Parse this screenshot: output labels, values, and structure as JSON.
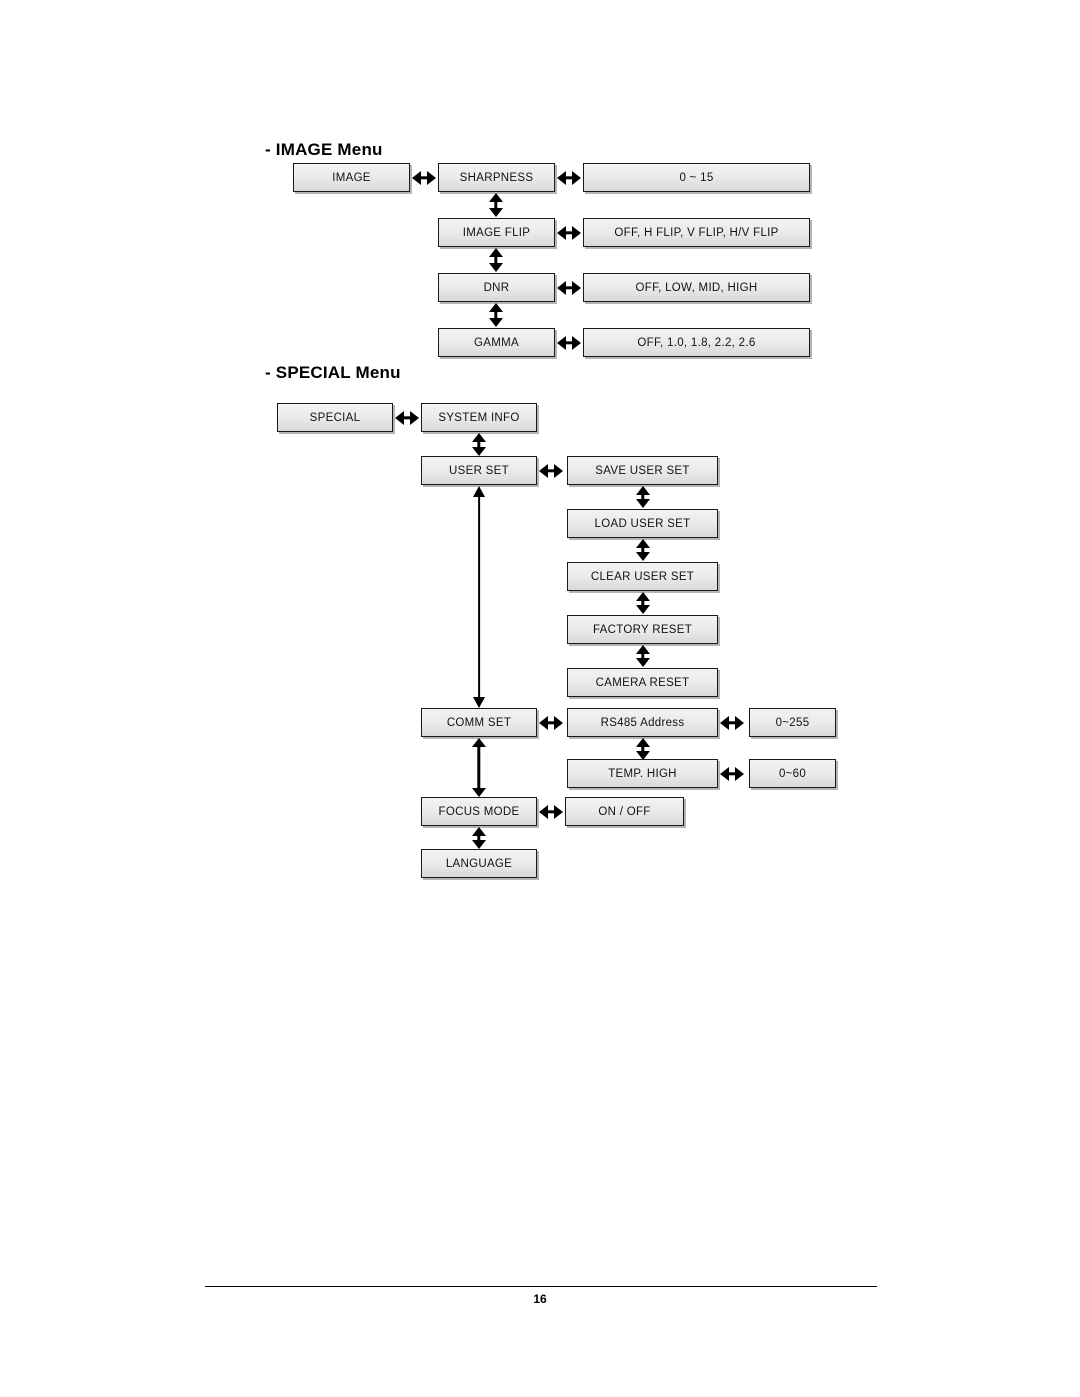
{
  "document": {
    "page_number": "16"
  },
  "sections": [
    {
      "id": "image-menu",
      "title": "- IMAGE Menu",
      "root": {
        "label": "IMAGE"
      },
      "rows": [
        {
          "item": "SHARPNESS",
          "values": "0 ~ 15"
        },
        {
          "item": "IMAGE FLIP",
          "values": "OFF, H FLIP, V FLIP, H/V FLIP"
        },
        {
          "item": "DNR",
          "values": "OFF, LOW, MID, HIGH"
        },
        {
          "item": "GAMMA",
          "values": "OFF, 1.0, 1.8, 2.2, 2.6"
        }
      ]
    },
    {
      "id": "special-menu",
      "title": "- SPECIAL Menu",
      "root": {
        "label": "SPECIAL"
      },
      "rows": [
        {
          "item": "SYSTEM INFO"
        },
        {
          "item": "USER SET"
        },
        {
          "item": "COMM SET"
        },
        {
          "item": "FOCUS MODE"
        },
        {
          "item": "LANGUAGE"
        }
      ],
      "user_set_children": [
        {
          "label": "SAVE USER SET"
        },
        {
          "label": "LOAD USER SET"
        },
        {
          "label": "CLEAR USER SET"
        },
        {
          "label": "FACTORY RESET"
        },
        {
          "label": "CAMERA RESET"
        }
      ],
      "comm_set_children": [
        {
          "label": "RS485 Address",
          "values": "0~255"
        },
        {
          "label": "TEMP. HIGH",
          "values": "0~60"
        }
      ],
      "focus_mode_children": [
        {
          "label": "ON / OFF"
        }
      ]
    }
  ]
}
